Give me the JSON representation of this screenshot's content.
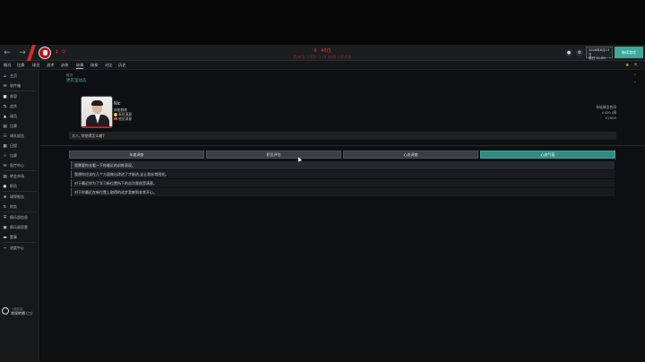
{
  "header": {
    "back_icon": "arrow-left-icon",
    "forward_icon": "arrow-right-icon",
    "title": "6 · 46位",
    "subtitle": "欧洲(女子)EFA U-19 (联赛·1/8)赛事",
    "date_line1": "2026年6月13日",
    "date_line2": "周日 11:00",
    "continue_label": "继续游戏",
    "accent_color": "#e0353f",
    "continue_color": "#3ea89b"
  },
  "menubar": {
    "items": [
      "概况",
      "比赛",
      "球员",
      "战术",
      "训练",
      "轮换",
      "球探",
      "对比",
      "历史"
    ]
  },
  "sidebar": {
    "items": [
      {
        "icon": "home-icon",
        "label": "主页"
      },
      {
        "icon": "inbox-icon",
        "label": "收件箱"
      },
      {
        "icon": "squad-icon",
        "label": "阵容"
      },
      {
        "icon": "tactics-icon",
        "label": "战术"
      },
      {
        "icon": "training-icon",
        "label": "球员"
      },
      {
        "icon": "data-icon",
        "label": "比赛"
      },
      {
        "icon": "schedule-icon",
        "label": "球队报告"
      },
      {
        "icon": "stats-icon",
        "label": "日程"
      },
      {
        "icon": "trophy-icon",
        "label": "比赛"
      },
      {
        "icon": "mail-icon",
        "label": "医疗中心"
      },
      {
        "icon": "transfer-icon",
        "label": "转会市场"
      },
      {
        "icon": "staff-icon",
        "label": "职员"
      },
      {
        "icon": "dev-icon",
        "label": "球探报告"
      },
      {
        "icon": "youth-icon",
        "label": "财务"
      },
      {
        "icon": "board-icon",
        "label": "俱乐部信息"
      },
      {
        "icon": "finance-icon",
        "label": "俱乐部愿景"
      },
      {
        "icon": "club-icon",
        "label": "董事"
      },
      {
        "icon": "vision-icon",
        "label": "进度中心"
      }
    ],
    "footer_line1": "一般状态",
    "footer_line2": "常规转播 (三)"
  },
  "main": {
    "breadcrumb": "概况",
    "title": "更衣室动态",
    "person": {
      "name": "Nic",
      "role": "体能教练",
      "status": "表现满意",
      "note": "感觉满意"
    },
    "fin_label": "年轻球员合同",
    "fin_value1": "£420 /周",
    "fin_value2": "£2000",
    "quote": "大人, 你觉得怎么着?",
    "tabs": [
      "年度调查",
      "职员评估",
      "心态调查",
      "心态气氛"
    ],
    "active_tab": 3,
    "rows": [
      "我需要你去看一下你最近的训练表现。",
      "我想你应该在几个方面做出改进了才能进,这让我非常困扰。",
      "对于最近你为了学习新位置所下的苦功我很是满意。",
      "对于你最近在新位置上取得的进步我感到非常开心。"
    ]
  }
}
